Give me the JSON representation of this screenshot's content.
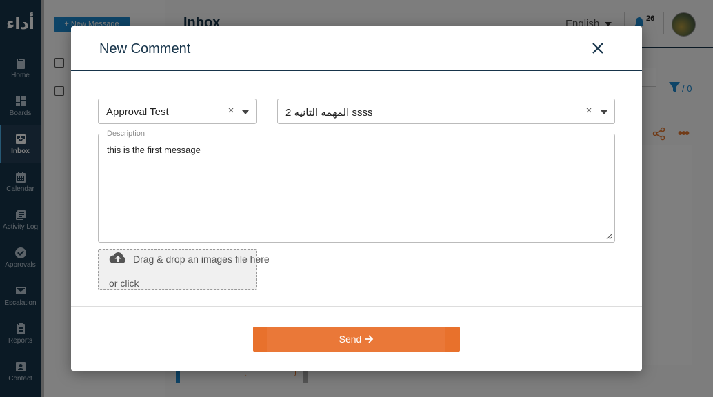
{
  "sidebar": {
    "logo": "أداء",
    "items": [
      {
        "label": "Home",
        "icon": "clipboard-icon"
      },
      {
        "label": "Boards",
        "icon": "grid-icon"
      },
      {
        "label": "Inbox",
        "icon": "inbox-icon",
        "active": true
      },
      {
        "label": "Calendar",
        "icon": "calendar-icon"
      },
      {
        "label": "Activity Log",
        "icon": "activity-log-icon"
      },
      {
        "label": "Approvals",
        "icon": "check-circle-icon"
      },
      {
        "label": "Escalation",
        "icon": "mail-icon"
      },
      {
        "label": "Reports",
        "icon": "report-icon"
      },
      {
        "label": "Contact",
        "icon": "contact-icon"
      }
    ]
  },
  "background": {
    "new_message_label": "+ New Message",
    "page_title": "Inbox",
    "language": "English",
    "notification_count": "26",
    "filter_count": "/ 0"
  },
  "modal": {
    "title": "New Comment",
    "project_select": {
      "value": "Approval Test"
    },
    "task_select": {
      "value": "المهمه الثانيه 2 ssss"
    },
    "description": {
      "label": "Description",
      "value": "this is the first message"
    },
    "dropzone": {
      "line1": "Drag & drop an images file here",
      "line2": "or click"
    },
    "send_label": "Send"
  },
  "colors": {
    "sidebar": "#17344a",
    "accent_blue": "#1d89cf",
    "send_orange": "#e8712c"
  }
}
